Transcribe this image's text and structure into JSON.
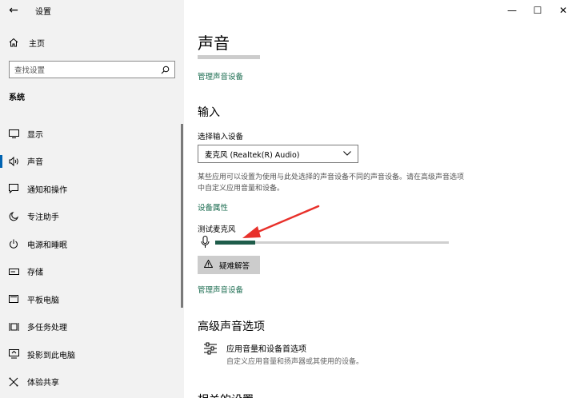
{
  "window": {
    "back_icon": "back-arrow-icon",
    "app_title": "设置",
    "controls": {
      "minimize": "—",
      "maximize": "☐",
      "close": "✕"
    }
  },
  "sidebar": {
    "home_label": "主页",
    "search_placeholder": "查找设置",
    "section_title": "系统",
    "items": [
      {
        "label": "显示",
        "icon": "display-icon",
        "active": false
      },
      {
        "label": "声音",
        "icon": "speaker-icon",
        "active": true
      },
      {
        "label": "通知和操作",
        "icon": "notification-icon",
        "active": false
      },
      {
        "label": "专注助手",
        "icon": "moon-icon",
        "active": false
      },
      {
        "label": "电源和睡眠",
        "icon": "power-icon",
        "active": false
      },
      {
        "label": "存储",
        "icon": "storage-icon",
        "active": false
      },
      {
        "label": "平板电脑",
        "icon": "tablet-icon",
        "active": false
      },
      {
        "label": "多任务处理",
        "icon": "multitask-icon",
        "active": false
      },
      {
        "label": "投影到此电脑",
        "icon": "project-icon",
        "active": false
      },
      {
        "label": "体验共享",
        "icon": "share-icon",
        "active": false
      }
    ]
  },
  "main": {
    "title": "声音",
    "manage_devices_link": "管理声音设备",
    "input": {
      "heading": "输入",
      "select_label": "选择输入设备",
      "selected_device": "麦克风 (Realtek(R) Audio)",
      "description": "某些应用可以设置为使用与此处选择的声音设备不同的声音设备。请在高级声音选项中自定义应用音量和设备。",
      "properties_link": "设备属性",
      "test_label": "测试麦克风",
      "level_fraction": 0.17,
      "troubleshoot_label": "疑难解答",
      "manage_devices_link": "管理声音设备"
    },
    "advanced": {
      "heading": "高级声音选项",
      "item_title": "应用音量和设备首选项",
      "item_desc": "自定义应用音量和扬声器或其使用的设备。",
      "cutoff_heading": "相关的设置"
    }
  },
  "colors": {
    "accent": "#1a6b4f",
    "active_indicator": "#0063b1",
    "annotation_arrow": "#e8302a"
  }
}
